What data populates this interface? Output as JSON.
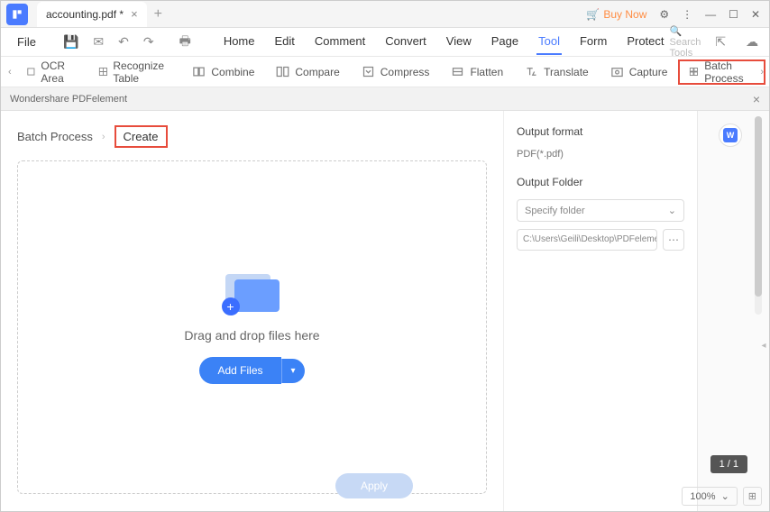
{
  "titlebar": {
    "filename": "accounting.pdf *",
    "buy_now": "Buy Now"
  },
  "menu": {
    "file": "File",
    "tabs": [
      "Home",
      "Edit",
      "Comment",
      "Convert",
      "View",
      "Page",
      "Tool",
      "Form",
      "Protect"
    ],
    "active_tab": "Tool",
    "search_placeholder": "Search Tools"
  },
  "toolbar": {
    "items": [
      "OCR Area",
      "Recognize Table",
      "Combine",
      "Compare",
      "Compress",
      "Flatten",
      "Translate",
      "Capture",
      "Batch Process"
    ]
  },
  "panel": {
    "title": "Wondershare PDFelement"
  },
  "breadcrumb": {
    "root": "Batch Process",
    "current": "Create"
  },
  "dropzone": {
    "text": "Drag and drop files here",
    "add_files": "Add Files"
  },
  "output": {
    "format_label": "Output format",
    "format_value": "PDF(*.pdf)",
    "folder_label": "Output Folder",
    "folder_select": "Specify folder",
    "folder_path": "C:\\Users\\Geili\\Desktop\\PDFelement\\Cr"
  },
  "footer": {
    "apply": "Apply",
    "page_indicator": "1 / 1",
    "zoom": "100%"
  }
}
